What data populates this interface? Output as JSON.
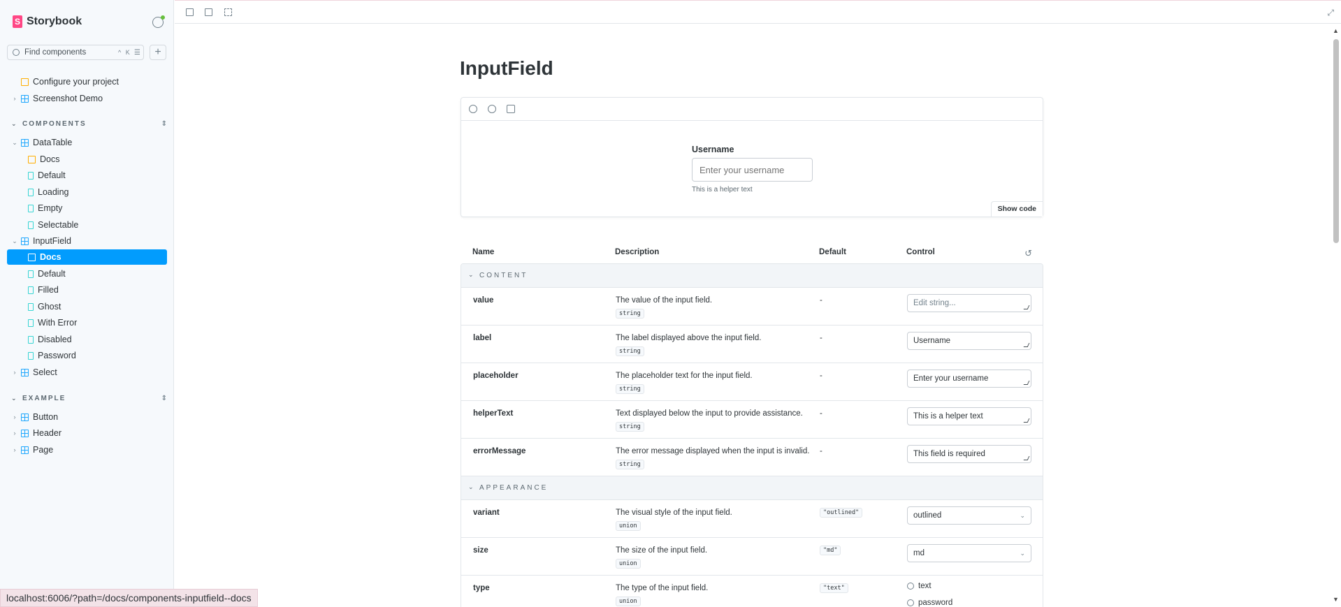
{
  "sidebar": {
    "brand": "Storybook",
    "search_placeholder": "Find components",
    "search_shortcut": "^ K",
    "top_items": [
      {
        "label": "Configure your project"
      },
      {
        "label": "Screenshot Demo"
      }
    ],
    "sections": [
      {
        "title": "COMPONENTS"
      },
      {
        "title": "EXAMPLE"
      }
    ],
    "components": {
      "datatable": {
        "label": "DataTable",
        "stories": [
          "Docs",
          "Default",
          "Loading",
          "Empty",
          "Selectable"
        ]
      },
      "inputfield": {
        "label": "InputField",
        "stories": [
          "Docs",
          "Default",
          "Filled",
          "Ghost",
          "With Error",
          "Disabled",
          "Password"
        ]
      },
      "select": {
        "label": "Select"
      }
    },
    "example": [
      "Button",
      "Header",
      "Page"
    ]
  },
  "status_url": "localhost:6006/?path=/docs/components-inputfield--docs",
  "doc": {
    "title": "InputField",
    "preview": {
      "label": "Username",
      "placeholder": "Enter your username",
      "helper": "This is a helper text",
      "show_code": "Show code"
    },
    "args_table": {
      "headers": {
        "name": "Name",
        "description": "Description",
        "default": "Default",
        "control": "Control"
      },
      "groups": {
        "content": {
          "title": "CONTENT",
          "rows": [
            {
              "name": "value",
              "description": "The value of the input field.",
              "type": "string",
              "default": "-",
              "control": "Edit string..."
            },
            {
              "name": "label",
              "description": "The label displayed above the input field.",
              "type": "string",
              "default": "-",
              "control": "Username"
            },
            {
              "name": "placeholder",
              "description": "The placeholder text for the input field.",
              "type": "string",
              "default": "-",
              "control": "Enter your username"
            },
            {
              "name": "helperText",
              "description": "Text displayed below the input to provide assistance.",
              "type": "string",
              "default": "-",
              "control": "This is a helper text"
            },
            {
              "name": "errorMessage",
              "description": "The error message displayed when the input is invalid.",
              "type": "string",
              "default": "-",
              "control": "This field is required"
            }
          ]
        },
        "appearance": {
          "title": "APPEARANCE",
          "rows": [
            {
              "name": "variant",
              "description": "The visual style of the input field.",
              "type": "union",
              "default": "\"outlined\"",
              "control": "outlined"
            },
            {
              "name": "size",
              "description": "The size of the input field.",
              "type": "union",
              "default": "\"md\"",
              "control": "md"
            },
            {
              "name": "type",
              "description": "The type of the input field.",
              "type": "union",
              "default": "\"text\"",
              "options": [
                "text",
                "password"
              ]
            }
          ]
        }
      }
    }
  },
  "colors": {
    "accent": "#029cfd",
    "brand": "#ff4785",
    "doc_icon": "#ffae00",
    "component_icon": "#1ea7fd",
    "story_icon": "#37d5d3"
  },
  "icons": [
    "settings-icon",
    "search-icon",
    "filter-icon",
    "plus-icon",
    "chevron-down-icon",
    "chevron-right-icon",
    "zoom-in-icon",
    "zoom-out-icon",
    "zoom-reset-icon",
    "reset-icon",
    "fullscreen-icon"
  ]
}
